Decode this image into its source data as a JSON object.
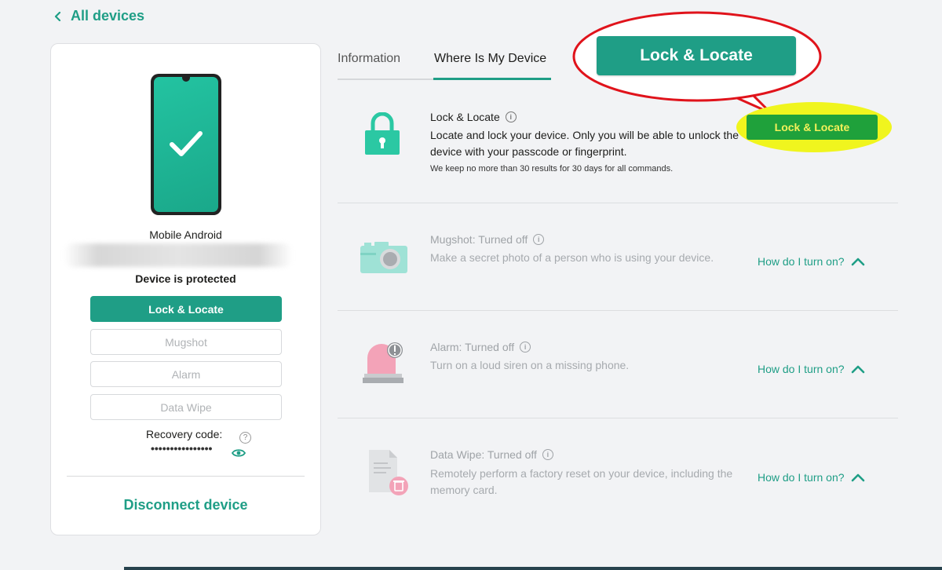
{
  "header": {
    "back_label": "All devices"
  },
  "device": {
    "name": "Mobile Android",
    "status": "Device is protected",
    "buttons": [
      {
        "label": "Lock & Locate",
        "active": true
      },
      {
        "label": "Mugshot",
        "active": false
      },
      {
        "label": "Alarm",
        "active": false
      },
      {
        "label": "Data Wipe",
        "active": false
      }
    ],
    "recovery_label": "Recovery code:",
    "recovery_help": "?",
    "recovery_value": "••••••••••••••••",
    "disconnect_label": "Disconnect device"
  },
  "tabs": [
    {
      "label": "Information",
      "active": false
    },
    {
      "label": "Where Is My Device",
      "active": true
    }
  ],
  "annotation": {
    "callout_label": "Lock & Locate"
  },
  "features": {
    "lock": {
      "title": "Lock & Locate",
      "desc": "Locate and lock your device. Only you will be able to unlock the device with your passcode or fingerprint.",
      "note": "We keep no more than 30 results for 30 days for all commands.",
      "button_label": "Lock & Locate"
    },
    "mugshot": {
      "title": "Mugshot: Turned off",
      "desc": "Make a secret photo of a person who is using your device.",
      "howto": "How do I turn on?"
    },
    "alarm": {
      "title": "Alarm: Turned off",
      "desc": "Turn on a loud siren on a missing phone.",
      "howto": "How do I turn on?"
    },
    "wipe": {
      "title": "Data Wipe: Turned off",
      "desc": "Remotely perform a factory reset on your device, including the memory card.",
      "howto": "How do I turn on?"
    }
  },
  "info_glyph": "i",
  "colors": {
    "accent": "#1f9e86",
    "annotation_red": "#e0131b",
    "highlight_yellow": "#f0f51e",
    "highlight_green": "#1fa13b"
  },
  "icons": [
    "chevron-left-icon",
    "checkmark-icon",
    "eye-icon",
    "padlock-icon",
    "camera-icon",
    "siren-icon",
    "document-trash-icon",
    "chevron-up-icon",
    "info-icon"
  ]
}
